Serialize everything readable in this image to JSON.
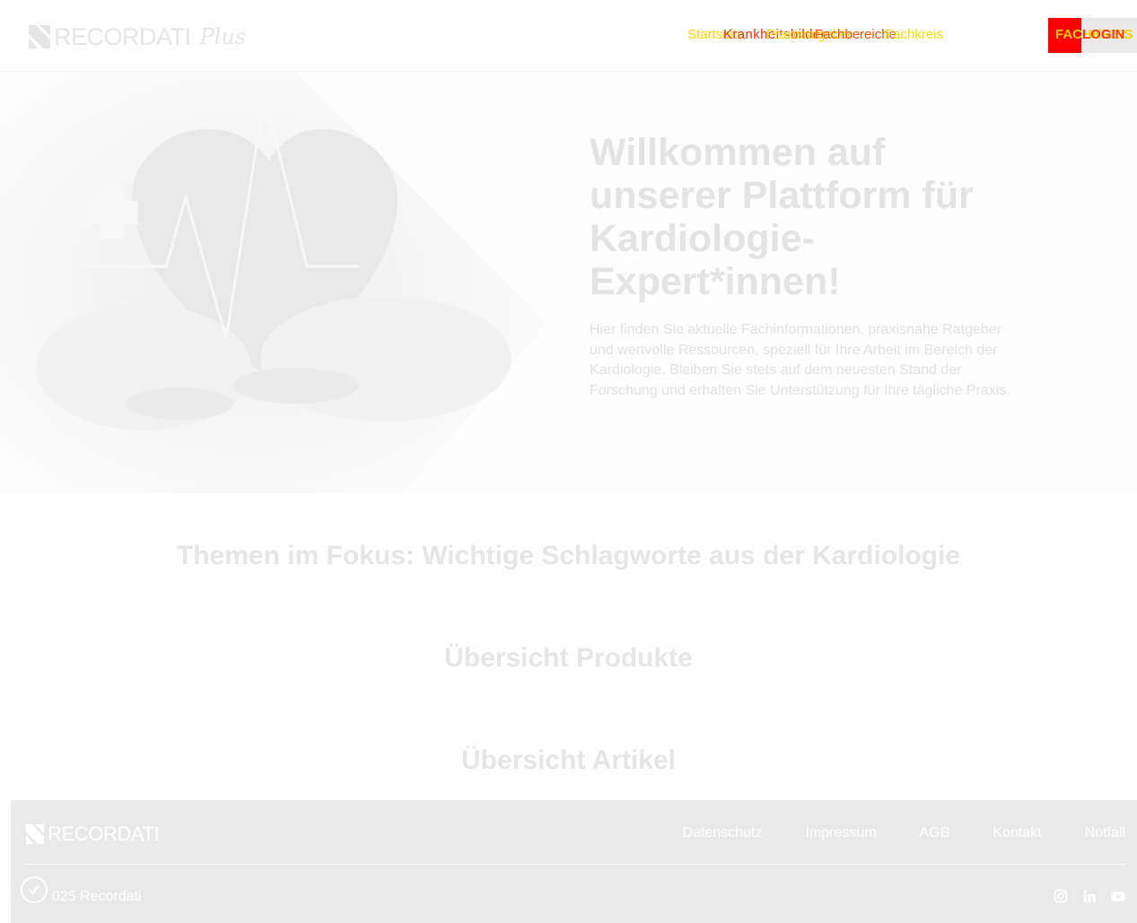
{
  "brand": {
    "name": "RECORDATI",
    "suffix": "Plus"
  },
  "nav": {
    "overlap_1": "Startseite",
    "overlap_2": "Krankheitsbilder",
    "overlap_3": "Praxisratgeber",
    "overlap_4": "Fachbereiche",
    "overlap_5": "Fachkreis",
    "cta_1": "FACHKREIS",
    "cta_2": "LOGIN"
  },
  "hero": {
    "title": "Willkommen auf unserer Plattform für Kardiologie-Expert*innen!",
    "text": "Hier finden Sie aktuelle Fachinformationen, praxisnahe Ratgeber und wertvolle Ressourcen, speziell für Ihre Arbeit im Bereich der Kardiologie. Bleiben Sie stets auf dem neuesten Stand der Forschung und erhalten Sie Unterstützung für Ihre tägliche Praxis."
  },
  "sections": {
    "topics": "Themen im Fokus: Wichtige Schlagworte aus der Kardiologie",
    "products": "Übersicht Produkte",
    "articles": "Übersicht Artikel"
  },
  "footer": {
    "brand": "RECORDATI",
    "links": [
      "Datenschutz",
      "Impressum",
      "AGB",
      "Kontakt",
      "Notfall"
    ],
    "copyright": "025 Recordati",
    "social_icons": [
      "instagram-icon",
      "linkedin-icon",
      "youtube-icon"
    ]
  },
  "colors": {
    "header_bg": "#ffffff",
    "footer_bg": "#eaeaea",
    "cta_red": "#ff0000",
    "cta_grey": "#e9e9e9",
    "heading_text": "#e4e4e4"
  }
}
